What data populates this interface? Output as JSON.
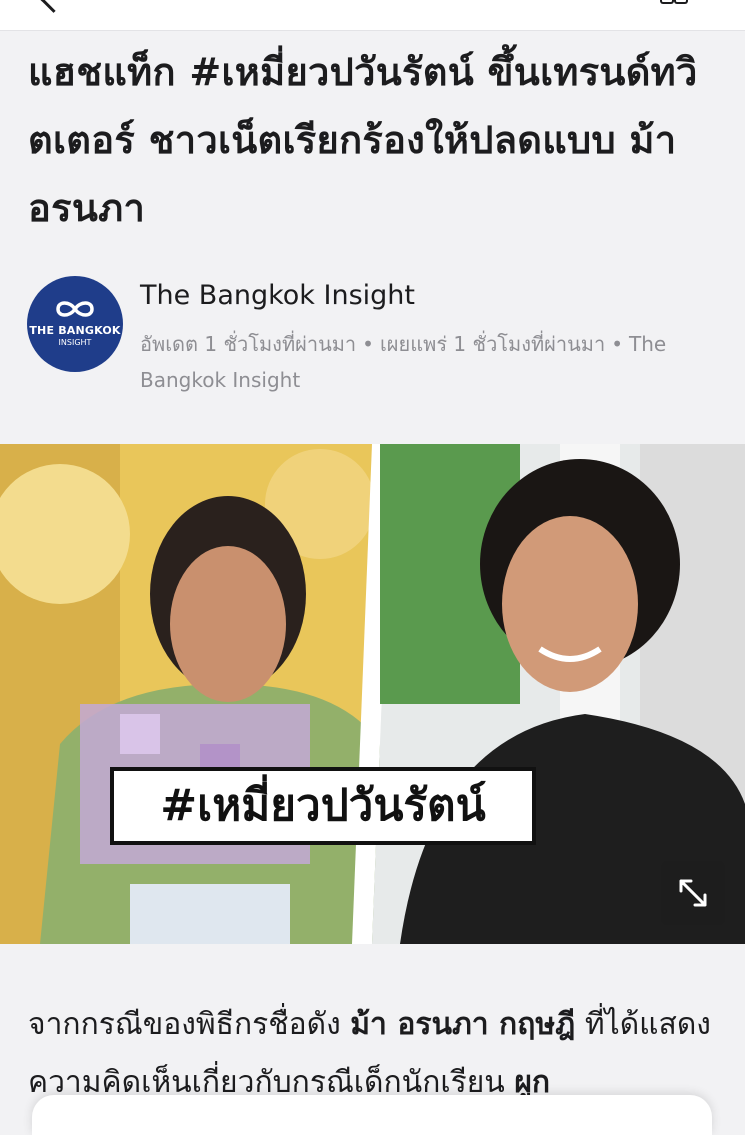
{
  "article": {
    "headline": "แฮชแท็ก #เหมี่ยวปวันรัตน์ ขึ้นเทรนด์ทวิตเตอร์ ชาวเน็ตเรียกร้องให้ปลดแบบ ม้า อรนภา",
    "author": {
      "name": "The Bangkok Insight",
      "logo_text_line1": "THE BANGKOK",
      "logo_text_line2": "INSIGHT"
    },
    "meta": {
      "updated": "อัพเดต 1 ชั่วโมงที่ผ่านมา",
      "separator": "•",
      "published": "เผยแพร่ 1 ชั่วโมงที่ผ่านมา",
      "source": "The Bangkok Insight"
    },
    "image": {
      "overlay_hashtag": "#เหมี่ยวปวันรัตน์"
    },
    "body": {
      "p1_a": "จากกรณีของพิธีกรชื่อดัง ",
      "p1_b": "ม้า อรนภา กฤษฎี",
      "p1_c": " ที่ได้แสดงความคิดเห็นเกี่ยวกับกรณีเด็กนักเรียน ",
      "p1_d": "ผูก"
    }
  },
  "icons": {
    "back": "chevron-left-icon",
    "top_right": "reader-mode-icon",
    "expand": "expand-icon"
  },
  "colors": {
    "background": "#f2f2f4",
    "logo_bg": "#1f3d8a",
    "meta_text": "#8e8e93"
  }
}
